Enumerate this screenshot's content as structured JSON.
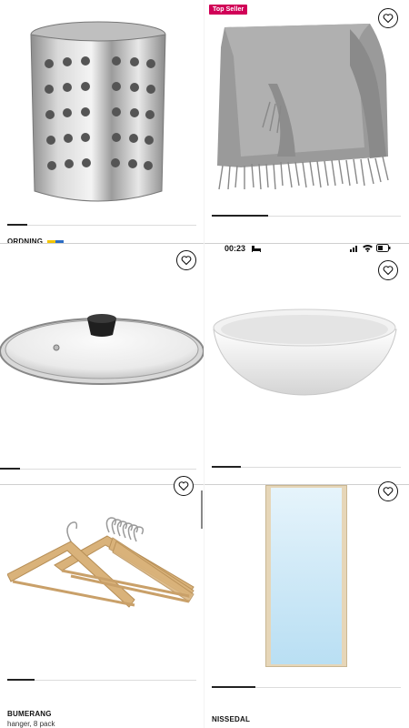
{
  "badge": {
    "label": "Top Seller"
  },
  "status_bar": {
    "time": "00:23"
  },
  "products": {
    "ordning": {
      "name": "ORDNING"
    },
    "bumerang": {
      "name": "BUMERANG",
      "description": "hanger, 8 pack"
    },
    "nissedal": {
      "name": "NISSEDAL"
    }
  },
  "icons": {
    "favorite": "heart-outline-icon",
    "bed": "bed-icon",
    "signal": "signal-icon",
    "wifi": "wifi-icon",
    "battery": "battery-icon"
  },
  "colors": {
    "badge": "#d10057",
    "mirror_frame": "#e6d6b8",
    "mirror_glass": "#cfe9f7",
    "hanger_wood": "#d9b27a"
  }
}
